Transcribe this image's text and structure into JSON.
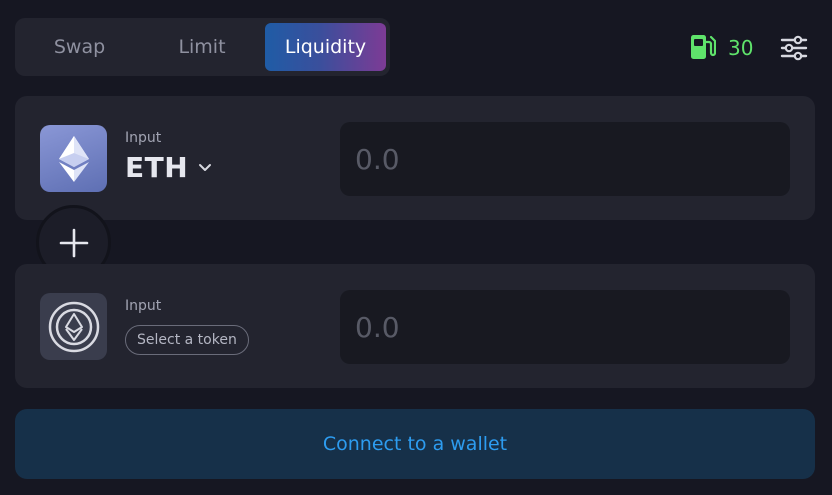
{
  "tabs": [
    {
      "label": "Swap",
      "active": false
    },
    {
      "label": "Limit",
      "active": false
    },
    {
      "label": "Liquidity",
      "active": true
    }
  ],
  "header": {
    "gas_icon": "gas-pump-icon",
    "gas_value": "30",
    "gas_color": "#5fe36b",
    "settings_icon": "sliders-icon"
  },
  "panel1": {
    "token_icon": "eth-icon",
    "input_label": "Input",
    "token_symbol": "ETH",
    "dropdown_icon": "chevron-down-icon",
    "amount_placeholder": "0.0"
  },
  "plus_icon": "plus-icon",
  "panel2": {
    "token_icon": "eth-circle-icon",
    "input_label": "Input",
    "select_label": "Select a token",
    "amount_placeholder": "0.0"
  },
  "connect": {
    "label": "Connect to a wallet",
    "color": "#2d9cf0"
  },
  "colors": {
    "background": "#161722",
    "panel": "#23242f",
    "accent_gradient_start": "#1f5ca6",
    "accent_gradient_end": "#7d3b95"
  }
}
